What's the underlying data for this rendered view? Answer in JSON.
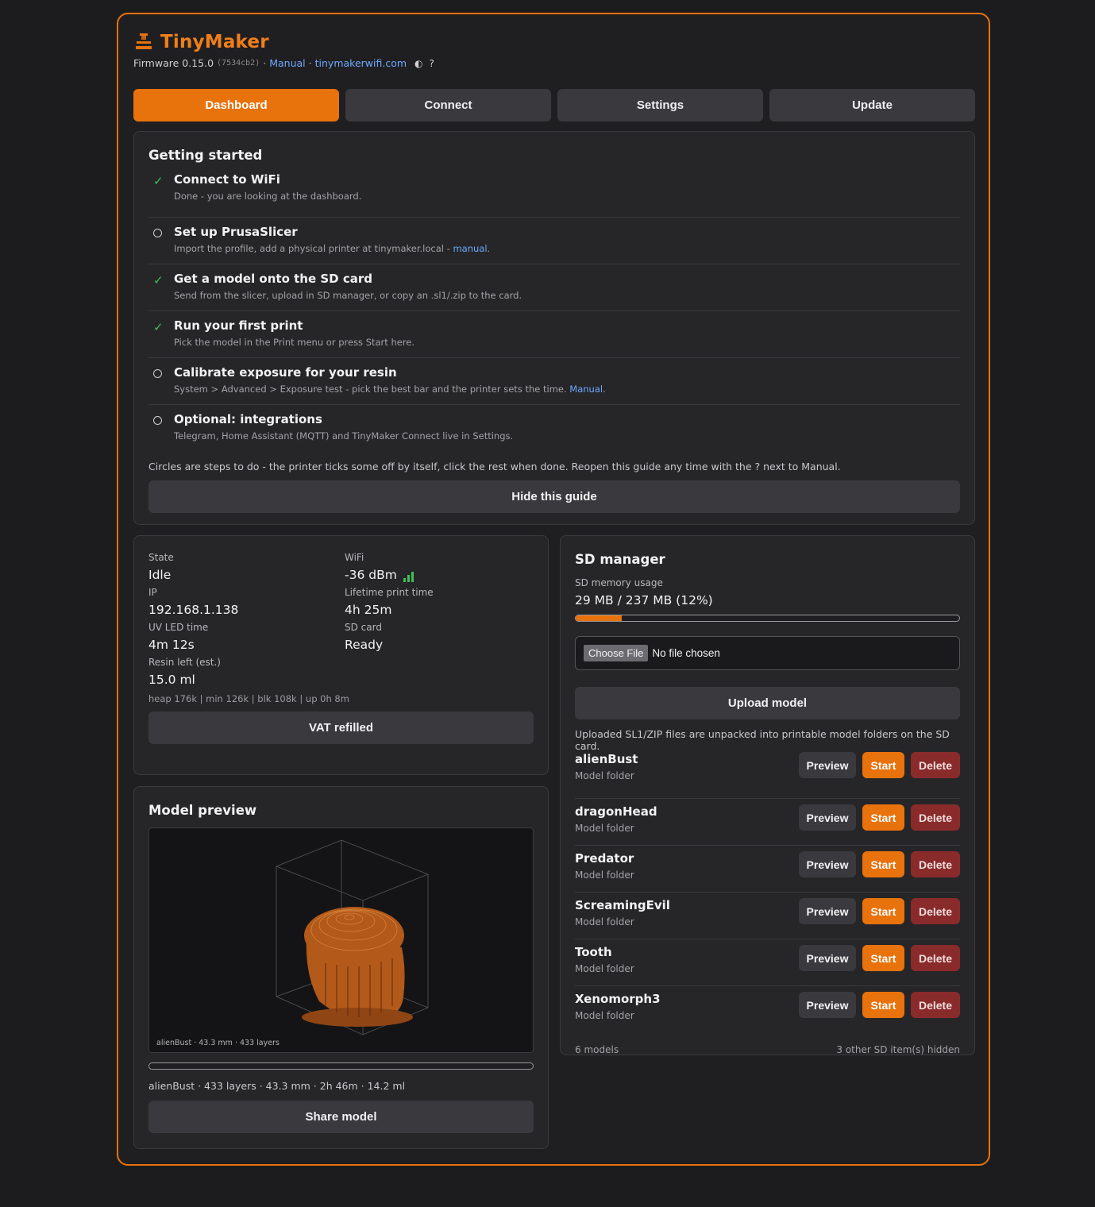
{
  "app": {
    "title": "TinyMaker",
    "firmware_label": "Firmware 0.15.0",
    "firmware_hash": "(7534cb2)",
    "sep": "·",
    "manual_link": "Manual",
    "site_link": "tinymakerwifi.com",
    "theme_icon": "◐",
    "help_icon": "?"
  },
  "tabs": [
    {
      "label": "Dashboard",
      "active": true
    },
    {
      "label": "Connect",
      "active": false
    },
    {
      "label": "Settings",
      "active": false
    },
    {
      "label": "Update",
      "active": false
    }
  ],
  "guide": {
    "title": "Getting started",
    "steps": [
      {
        "done": true,
        "title": "Connect to WiFi",
        "desc": "Done - you are looking at the dashboard."
      },
      {
        "done": false,
        "title": "Set up PrusaSlicer",
        "desc": "Import the profile, add a physical printer at tinymaker.local - ",
        "link": "manual",
        "after": "."
      },
      {
        "done": true,
        "title": "Get a model onto the SD card",
        "desc": "Send from the slicer, upload in SD manager, or copy an .sl1/.zip to the card."
      },
      {
        "done": true,
        "title": "Run your first print",
        "desc": "Pick the model in the Print menu or press Start here."
      },
      {
        "done": false,
        "title": "Calibrate exposure for your resin",
        "desc": "System > Advanced > Exposure test - pick the best bar and the printer sets the time. ",
        "link": "Manual",
        "after": "."
      },
      {
        "done": false,
        "title": "Optional: integrations",
        "desc": "Telegram, Home Assistant (MQTT) and TinyMaker Connect live in Settings."
      }
    ],
    "note": "Circles are steps to do - the printer ticks some off by itself, click the rest when done. Reopen this guide any time with the ? next to Manual.",
    "hide_button": "Hide this guide"
  },
  "status": {
    "state_label": "State",
    "state": "Idle",
    "wifi_label": "WiFi",
    "wifi": "-36 dBm",
    "wifi_bars": 3,
    "ip_label": "IP",
    "ip": "192.168.1.138",
    "lifetime_label": "Lifetime print time",
    "lifetime": "4h 25m",
    "uv_label": "UV LED time",
    "uv": "4m 12s",
    "sd_label": "SD card",
    "sd": "Ready",
    "resin_label": "Resin left (est.)",
    "resin": "15.0 ml",
    "heap": "heap 176k | min 126k | blk 108k | up 0h 8m",
    "vat_button": "VAT refilled"
  },
  "preview": {
    "title": "Model preview",
    "caption": "alienBust · 43.3 mm · 433 layers",
    "progress": 0,
    "info": "alienBust · 433 layers · 43.3 mm · 2h 46m · 14.2 ml",
    "share_button": "Share model"
  },
  "sd": {
    "title": "SD manager",
    "usage_label": "SD memory usage",
    "usage": "29 MB / 237 MB (12%)",
    "usage_fraction": 0.12,
    "choose_file": "Choose File",
    "no_file": "No file chosen",
    "upload_button": "Upload model",
    "note": "Uploaded SL1/ZIP files are unpacked into printable model folders on the SD card.",
    "models": [
      {
        "name": "alienBust",
        "sub": "Model folder"
      },
      {
        "name": "dragonHead",
        "sub": "Model folder"
      },
      {
        "name": "Predator",
        "sub": "Model folder"
      },
      {
        "name": "ScreamingEvil",
        "sub": "Model folder"
      },
      {
        "name": "Tooth",
        "sub": "Model folder"
      },
      {
        "name": "Xenomorph3",
        "sub": "Model folder"
      }
    ],
    "preview_label": "Preview",
    "start_label": "Start",
    "delete_label": "Delete",
    "count": "6 models",
    "hidden": "3 other SD item(s) hidden"
  },
  "colors": {
    "accent": "#e8720c",
    "done": "#3fbf5a",
    "danger": "#8a2b2b",
    "link": "#6ea8ff"
  }
}
